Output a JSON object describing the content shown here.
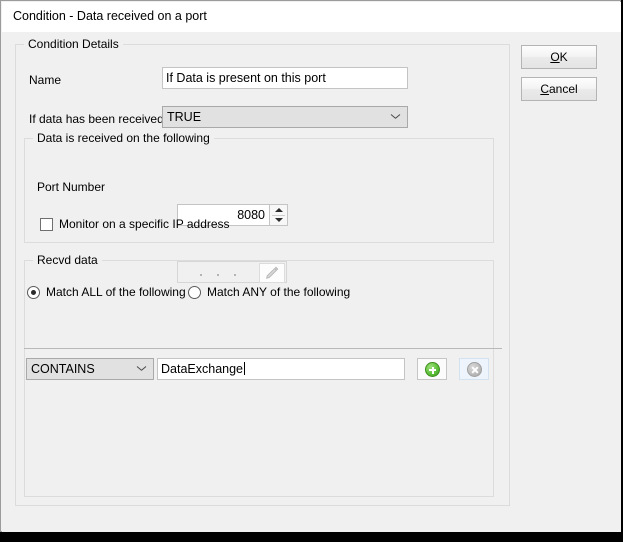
{
  "window": {
    "title": "Condition - Data received on a port"
  },
  "buttons": {
    "ok": {
      "mnemonic": "O",
      "rest": "K"
    },
    "cancel": {
      "mnemonic": "C",
      "rest": "ancel"
    }
  },
  "details_group": {
    "legend": "Condition Details",
    "name_label": "Name",
    "name_value": "If Data is present on this port",
    "received_label": "If data has been received",
    "received_value": "TRUE"
  },
  "port_group": {
    "legend": "Data is received on the following",
    "port_label": "Port Number",
    "port_value": "8080",
    "monitor_checkbox_label": "Monitor on a specific IP address",
    "monitor_checked": false,
    "ip_value": "",
    "ip_separators": ". . ."
  },
  "recvd_group": {
    "legend": "Recvd data",
    "match_all_label": "Match ALL of the following",
    "match_any_label": "Match ANY of the following",
    "selected_match": "all",
    "rule": {
      "operator": "CONTAINS",
      "value": "DataExchange"
    },
    "add_button_label": "",
    "delete_button_label": ""
  }
}
